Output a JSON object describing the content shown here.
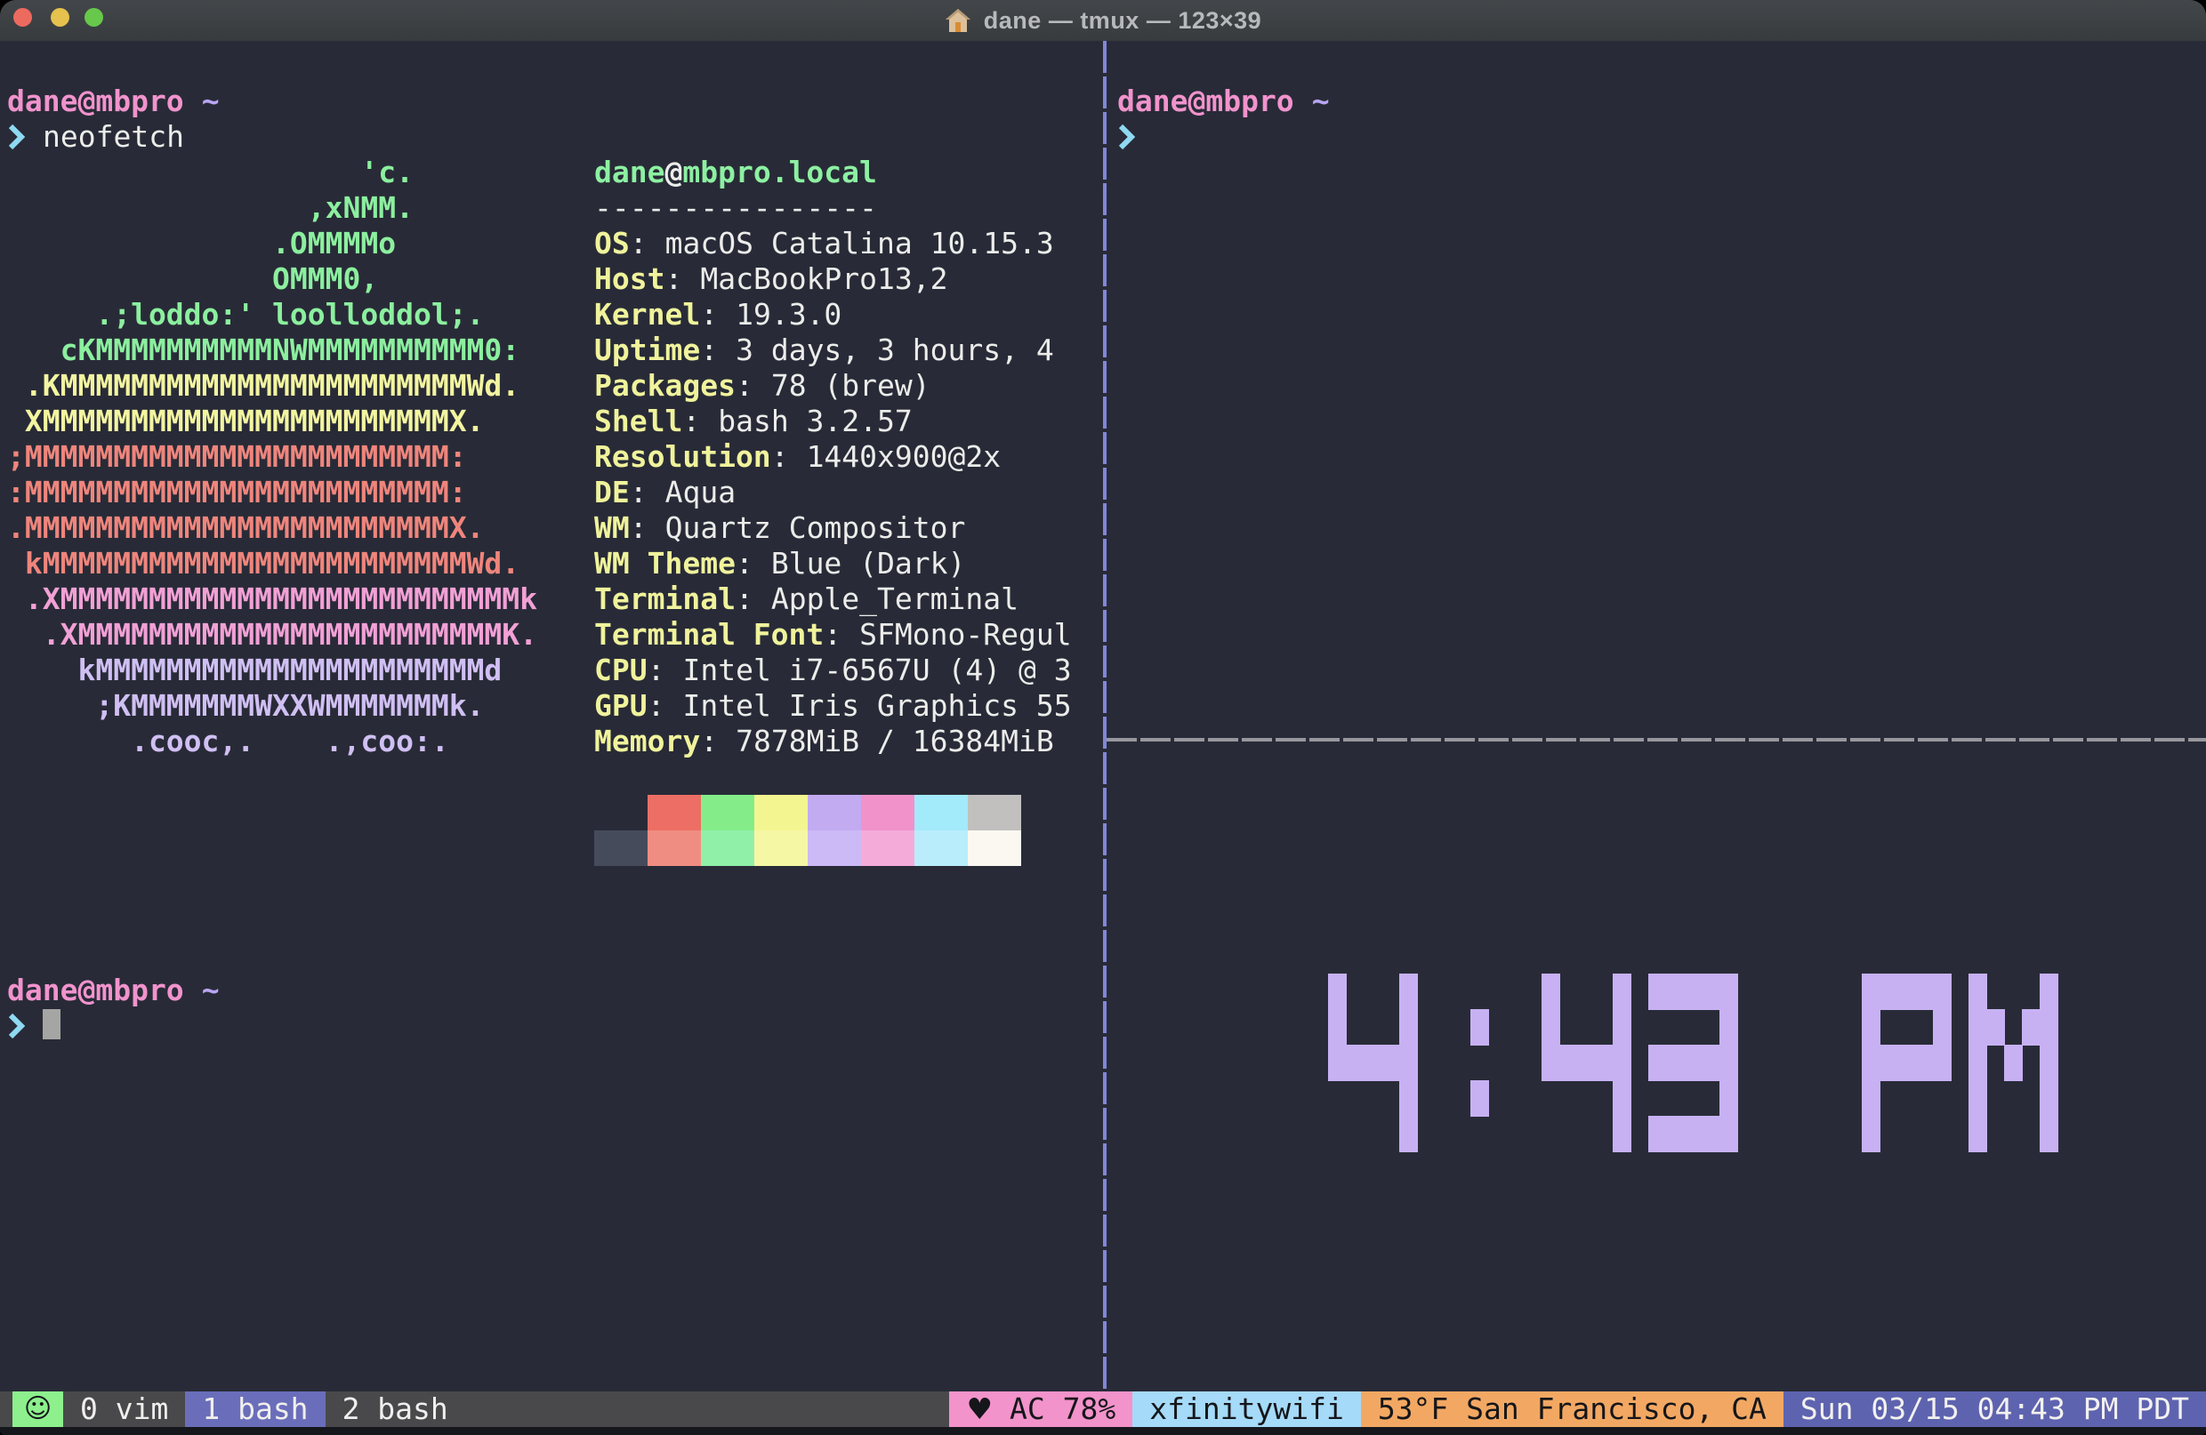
{
  "window": {
    "title": "dane — tmux — 123×39",
    "traffic_lights": {
      "close": "#ed6a5f",
      "minimize": "#e5c14d",
      "zoom": "#67c84c"
    }
  },
  "terminal": {
    "prompt": {
      "user": "dane@mbpro",
      "path": "~"
    },
    "command": "neofetch"
  },
  "neofetch": {
    "title": {
      "user": "dane",
      "at": "@",
      "host": "mbpro.local"
    },
    "separator": "----------------",
    "colon": ":",
    "art": [
      {
        "text": "                    'c.",
        "color": "#8cef9f"
      },
      {
        "text": "                 ,xNMM.",
        "color": "#8cef9f"
      },
      {
        "text": "               .OMMMMo",
        "color": "#8cef9f"
      },
      {
        "text": "               OMMM0,",
        "color": "#8cef9f"
      },
      {
        "text": "     .;loddo:' loolloddol;.",
        "color": "#8cef9f"
      },
      {
        "text": "   cKMMMMMMMMMMNWMMMMMMMMMM0:",
        "color": "#8cef9f"
      },
      {
        "text": " .KMMMMMMMMMMMMMMMMMMMMMMMWd.",
        "color": "#f3f5a0"
      },
      {
        "text": " XMMMMMMMMMMMMMMMMMMMMMMMX.",
        "color": "#f3f5a0"
      },
      {
        "text": ";MMMMMMMMMMMMMMMMMMMMMMMM:",
        "color": "#ef857c"
      },
      {
        "text": ":MMMMMMMMMMMMMMMMMMMMMMMM:",
        "color": "#ef857c"
      },
      {
        "text": ".MMMMMMMMMMMMMMMMMMMMMMMMX.",
        "color": "#ef857c"
      },
      {
        "text": " kMMMMMMMMMMMMMMMMMMMMMMMMWd.",
        "color": "#ef857c"
      },
      {
        "text": " .XMMMMMMMMMMMMMMMMMMMMMMMMMMk",
        "color": "#f2a0d6"
      },
      {
        "text": "  .XMMMMMMMMMMMMMMMMMMMMMMMMK.",
        "color": "#f2a0d6"
      },
      {
        "text": "    kMMMMMMMMMMMMMMMMMMMMMMd",
        "color": "#d0bff3"
      },
      {
        "text": "     ;KMMMMMMMWXXWMMMMMMMk.",
        "color": "#d0bff3"
      },
      {
        "text": "       .cooc,.    .,coo:.",
        "color": "#d0bff3"
      }
    ],
    "info": [
      {
        "label": "OS",
        "value": "macOS Catalina 10.15.3"
      },
      {
        "label": "Host",
        "value": "MacBookPro13,2"
      },
      {
        "label": "Kernel",
        "value": "19.3.0"
      },
      {
        "label": "Uptime",
        "value": "3 days, 3 hours, 4"
      },
      {
        "label": "Packages",
        "value": "78 (brew)"
      },
      {
        "label": "Shell",
        "value": "bash 3.2.57"
      },
      {
        "label": "Resolution",
        "value": "1440x900@2x"
      },
      {
        "label": "DE",
        "value": "Aqua"
      },
      {
        "label": "WM",
        "value": "Quartz Compositor"
      },
      {
        "label": "WM Theme",
        "value": "Blue (Dark)"
      },
      {
        "label": "Terminal",
        "value": "Apple_Terminal"
      },
      {
        "label": "Terminal Font",
        "value": "SFMono-Regul"
      },
      {
        "label": "CPU",
        "value": "Intel i7-6567U (4) @ 3"
      },
      {
        "label": "GPU",
        "value": "Intel Iris Graphics 55"
      },
      {
        "label": "Memory",
        "value": "7878MiB / 16384MiB"
      }
    ],
    "palette_row1": [
      "transparent",
      "#ed6e64",
      "#84ed8a",
      "#f3f690",
      "#c3abf2",
      "#f192cb",
      "#a3eafb",
      "#c1c0bf"
    ],
    "palette_row2": [
      "#464b5c",
      "#f08d82",
      "#90f0a8",
      "#f6f7a4",
      "#ccbaf6",
      "#f5abda",
      "#b9edfb",
      "#faf8f1"
    ]
  },
  "clock": {
    "time": "4:43 PM",
    "color": "#c7b1f3"
  },
  "status_bar": {
    "session_icon": "☺",
    "windows": [
      {
        "label": "0 vim",
        "active": false
      },
      {
        "label": "1 bash",
        "active": true
      },
      {
        "label": "2 bash",
        "active": false
      }
    ],
    "segments": [
      {
        "icon": "♥",
        "text": "AC 78%",
        "bg": "#f293cb",
        "fg": "#15161a"
      },
      {
        "icon": "",
        "text": "xfinitywifi",
        "bg": "#a5daf8",
        "fg": "#15161a"
      },
      {
        "icon": "",
        "text": "53°F San Francisco, CA",
        "bg": "#f2a863",
        "fg": "#15161a"
      },
      {
        "icon": "",
        "text": "Sun 03/15 04:43 PM PDT",
        "bg": "#5e63af",
        "fg": "#f2f1ef"
      }
    ]
  },
  "colors": {
    "bg": "#282b37",
    "fg": "#ececea",
    "prompt_user": "#f193cd",
    "prompt_path": "#b9a5f3",
    "chevron": "#8fd9f2",
    "title_green": "#8df0a2",
    "label_yellow": "#f0f39b",
    "cursor": "#a5a5a3",
    "clock_color": "#c7b1f3",
    "divider_v": "#8286d8",
    "divider_h": "#97979d",
    "status_bg": "#49494b",
    "session_bg": "#8df08d",
    "active_window_bg": "#6a6eba",
    "tl_close": "#ed6a5f",
    "tl_min": "#e5c14d",
    "tl_zoom": "#67c84c"
  }
}
